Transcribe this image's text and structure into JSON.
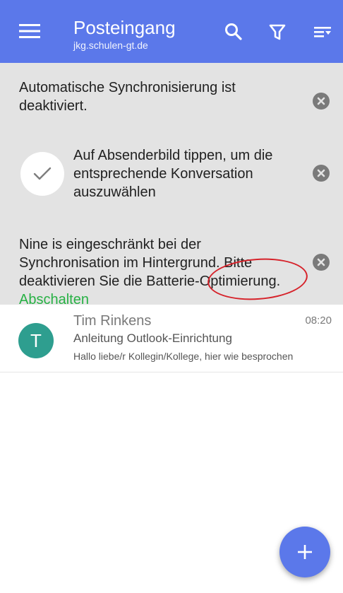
{
  "appbar": {
    "title": "Posteingang",
    "subtitle": "jkg.schulen-gt.de",
    "icons": [
      "menu-icon",
      "search-icon",
      "filter-icon",
      "sort-icon"
    ],
    "color": "#5b78ea"
  },
  "notices": [
    {
      "text": "Automatische Synchronisierung ist deaktiviert.",
      "icon": "close-icon"
    },
    {
      "text": "Auf Absenderbild tippen, um die entsprechende Konversation auszuwählen",
      "icon": "check-icon"
    },
    {
      "text": "Nine is eingeschränkt bei der Synchronisation im Hintergrund. Bitte deaktivieren Sie die Batterie-Optimierung.",
      "action": "Abschalten",
      "action_color": "#27b144"
    }
  ],
  "messages": [
    {
      "avatar_letter": "T",
      "avatar_color": "#2e9e8f",
      "sender": "Tim Rinkens",
      "time": "08:20",
      "subject": "Anleitung Outlook-Einrichtung",
      "preview": "Hallo liebe/r Kollegin/Kollege, hier wie besprochen"
    }
  ],
  "fab": {
    "icon": "plus-icon"
  }
}
